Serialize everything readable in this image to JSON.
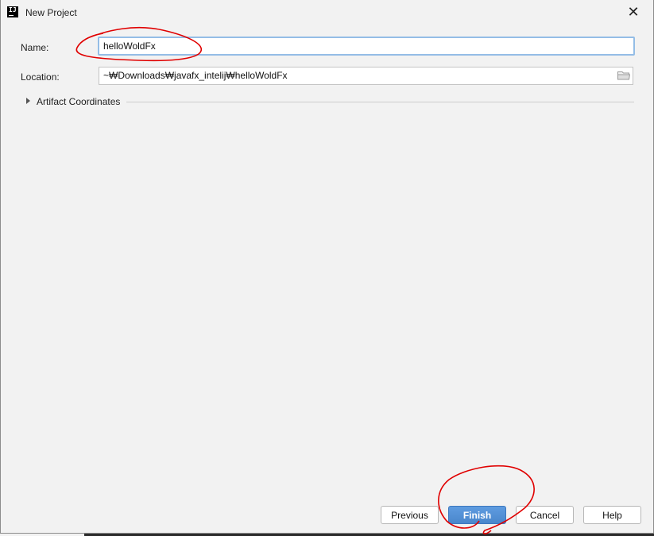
{
  "window": {
    "title": "New Project",
    "app_icon_text": "IJ",
    "close_glyph": "✕"
  },
  "form": {
    "name_label": "Name:",
    "name_value": "helloWoldFx",
    "location_label": "Location:",
    "location_value": "~₩Downloads₩javafx_intelij₩helloWoldFx",
    "artifact_label": "Artifact Coordinates"
  },
  "buttons": {
    "previous": "Previous",
    "finish": "Finish",
    "cancel": "Cancel",
    "help": "Help"
  },
  "colors": {
    "accent": "#4a87cc",
    "focus_border": "#94bde6",
    "annotation": "#e00000"
  },
  "icons": [
    "intellij-app-icon",
    "close-icon",
    "folder-icon",
    "expand-triangle-icon"
  ]
}
